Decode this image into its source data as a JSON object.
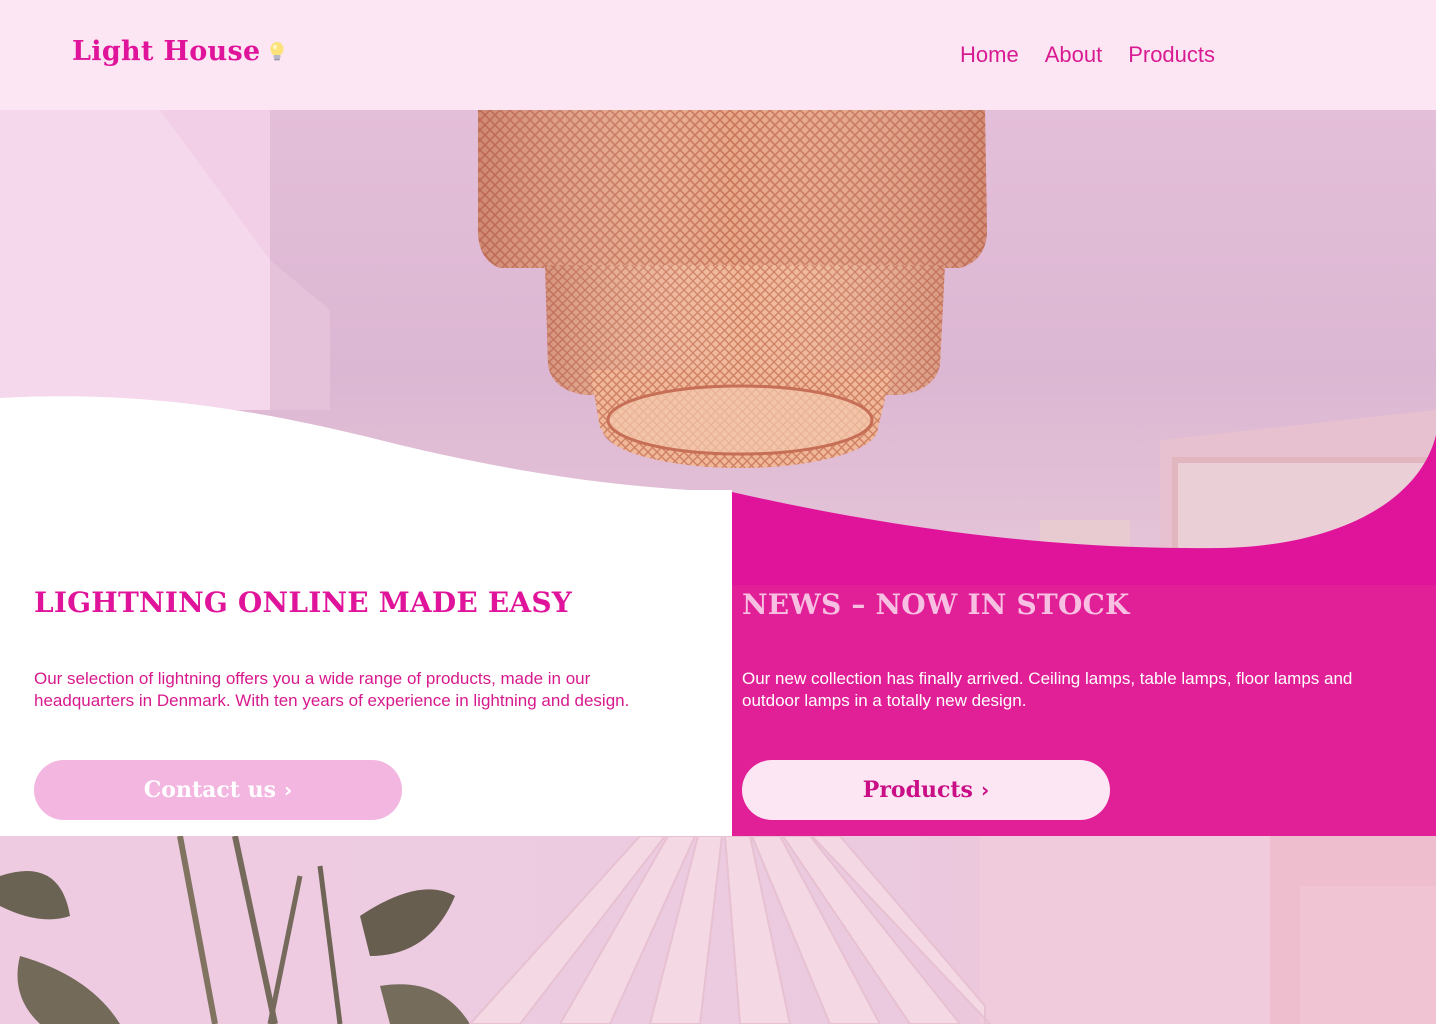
{
  "header": {
    "logo_text": "Light House",
    "logo_icon": "lightbulb-icon",
    "nav": [
      {
        "label": "Home"
      },
      {
        "label": "About"
      },
      {
        "label": "Products"
      }
    ]
  },
  "hero": {
    "image": "woven-pendant-lamp-photo"
  },
  "intro": {
    "headline": "LIGHTNING ONLINE MADE EASY",
    "text": "Our selection of lightning offers you a wide range of products, made in our headquarters in Denmark. With ten years of experience in lightning and design.",
    "button_label": "Contact us",
    "button_icon": "chevron-right-icon"
  },
  "news": {
    "headline": "NEWS – NOW IN STOCK",
    "text": "Our new collection has finally arrived. Ceiling lamps, table lamps, floor lamps and outdoor lamps in a totally new design.",
    "button_label": "Products",
    "button_icon": "chevron-right-icon"
  },
  "bottom": {
    "image": "plant-and-paper-lamp-photo"
  },
  "colors": {
    "accent": "#e0149a",
    "header_bg": "#fce6f3",
    "news_bg": "#e11f97",
    "contact_button_bg": "#f2b6e0"
  }
}
